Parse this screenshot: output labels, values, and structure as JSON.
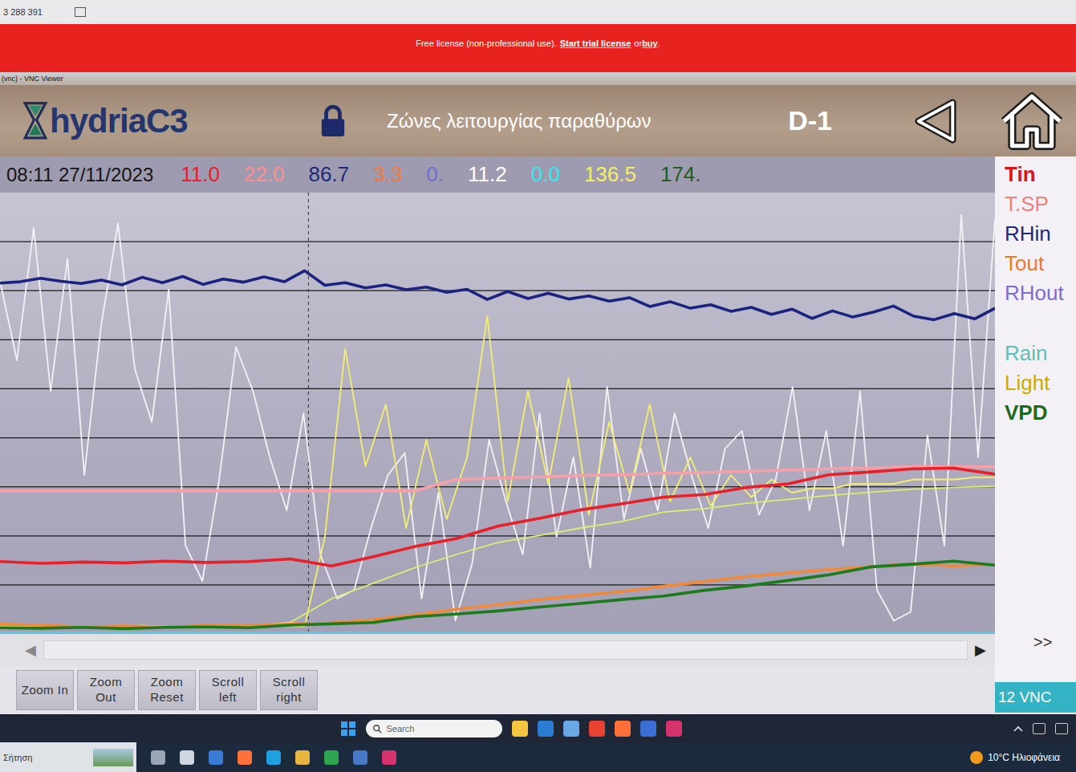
{
  "top_strip": {
    "text": "3 288 391"
  },
  "banner": {
    "prefix": "Free license (non-professional use).",
    "link1": "Start trial license",
    "middle": "or",
    "link2": "buy",
    "suffix": "."
  },
  "vnc_window": {
    "title": "(vnc) - VNC Viewer"
  },
  "header": {
    "logo": "hydriaC3",
    "title": "Ζώνες λειτουργίας παραθύρων",
    "screen_id": "D-1",
    "locked": true
  },
  "readouts": {
    "timestamp": "08:11 27/11/2023",
    "values": [
      {
        "value": "11.0",
        "color": "#e8202a"
      },
      {
        "value": "22.0",
        "color": "#ff8f8f"
      },
      {
        "value": "86.7",
        "color": "#1c2a7a"
      },
      {
        "value": "3.3",
        "color": "#f07a3a"
      },
      {
        "value": "0.",
        "color": "#6f6fd0"
      },
      {
        "value": "11.2",
        "color": "#ffffff"
      },
      {
        "value": "0.0",
        "color": "#35e8f0"
      },
      {
        "value": "136.5",
        "color": "#f4f060"
      },
      {
        "value": "174.",
        "color": "#1d5e1d"
      }
    ]
  },
  "legend": [
    {
      "name": "Tin",
      "color": "#d8141c",
      "bold": true
    },
    {
      "name": "T.SP",
      "color": "#ef8080",
      "bold": false
    },
    {
      "name": "RHin",
      "color": "#1c2a7a",
      "bold": false
    },
    {
      "name": "Tout",
      "color": "#f07a2a",
      "bold": false
    },
    {
      "name": "RHout",
      "color": "#7a6ed0",
      "bold": false
    },
    {
      "name": "Rain",
      "color": "#5cc0b6",
      "bold": false
    },
    {
      "name": "Light",
      "color": "#c9ac00",
      "bold": false
    },
    {
      "name": "VPD",
      "color": "#1d6a1d",
      "bold": true
    }
  ],
  "chart": {
    "cursor": {
      "level": 0.31
    },
    "series": [
      {
        "color": "#f4f1f4",
        "kind": "thin",
        "values": [
          80,
          62,
          92,
          55,
          85,
          36,
          70,
          93,
          60,
          48,
          78,
          20,
          12,
          35,
          65,
          55,
          40,
          28,
          50,
          18,
          8,
          10,
          24,
          36,
          41,
          8,
          32,
          3,
          16,
          44,
          30,
          18,
          50,
          22,
          40,
          15,
          56,
          26,
          42,
          28,
          50,
          36,
          24,
          42,
          46,
          27,
          35,
          56,
          28,
          46,
          20,
          55,
          10,
          3,
          5,
          45,
          20,
          95,
          40,
          94
        ]
      },
      {
        "color": "#f2ee70",
        "kind": "thin",
        "values": [
          1.8,
          1.6,
          1.9,
          1.5,
          1.7,
          1.8,
          1.6,
          1.9,
          1.7,
          1.6,
          1.8,
          1.7,
          1.9,
          1.6,
          1.8,
          1.7,
          22,
          64.6,
          38,
          52,
          24,
          44,
          26,
          40,
          72,
          30,
          55,
          34,
          58,
          27,
          48,
          32,
          52,
          30,
          40,
          29,
          36,
          31,
          35,
          32,
          33,
          33,
          34,
          34,
          34,
          35,
          35,
          35,
          35.5,
          35.5
        ]
      },
      {
        "color": "#d8f070",
        "kind": "thin",
        "values": [
          1.6,
          1.5,
          1.6,
          1.4,
          1.5,
          1.6,
          1.8,
          2.6,
          8.0,
          11.5,
          15.0,
          18.0,
          20.7,
          22.3,
          24.0,
          25.5,
          27.6,
          28.4,
          29.6,
          30.5,
          31.4,
          32.1,
          32.8,
          33.2,
          33.5
        ]
      },
      {
        "color": "#f4a0a8",
        "kind": "bold",
        "values": [
          32.4,
          32.4,
          32.4,
          32.4,
          32.4,
          32.4,
          32.4,
          32.4,
          32.4,
          32.4,
          32.4,
          35.0,
          35.3,
          35.6,
          35.9,
          36.1,
          36.4,
          36.6,
          36.9,
          37.1,
          37.4,
          37.6,
          37.9,
          37.9,
          37.9
        ]
      },
      {
        "color": "#1a2480",
        "kind": "bold",
        "values": [
          79.5,
          79.8,
          80.6,
          79.9,
          79.4,
          80.2,
          79.1,
          80.8,
          79.6,
          81.0,
          79.2,
          80.4,
          79.7,
          80.9,
          79.8,
          82.3,
          79.0,
          79.6,
          78.4,
          79.1,
          78.0,
          78.6,
          77.4,
          78.1,
          75.8,
          77.6,
          76.0,
          77.2,
          75.9,
          76.6,
          75.4,
          76.2,
          74.2,
          75.3,
          73.8,
          74.6,
          73.1,
          74.0,
          72.4,
          73.6,
          71.5,
          73.2,
          71.8,
          72.9,
          74.3,
          72.0,
          71.2,
          72.6,
          71.4,
          73.8
        ]
      },
      {
        "color": "#f08a3a",
        "kind": "bold",
        "values": [
          2.2,
          2.0,
          1.6,
          1.8,
          1.5,
          1.9,
          2.0,
          2.2,
          2.5,
          3.2,
          4.3,
          5.6,
          6.6,
          7.8,
          8.7,
          9.6,
          10.8,
          11.9,
          13.0,
          13.8,
          14.6,
          15.2,
          15.9,
          15.4,
          15.8
        ]
      },
      {
        "color": "#1d7a1d",
        "kind": "bold",
        "values": [
          1.4,
          1.3,
          1.5,
          1.2,
          1.5,
          1.6,
          1.4,
          2.0,
          2.3,
          2.6,
          3.9,
          4.5,
          5.2,
          6.1,
          6.9,
          7.8,
          8.6,
          9.9,
          10.9,
          12.1,
          13.4,
          15.2,
          15.8,
          16.5,
          15.6
        ]
      },
      {
        "color": "#e8202a",
        "kind": "bold",
        "values": [
          16.4,
          16.0,
          16.3,
          16.1,
          16.5,
          16.2,
          16.4,
          17.0,
          15.4,
          17.5,
          19.8,
          21.6,
          24.4,
          26.2,
          28.1,
          29.5,
          31.0,
          31.6,
          33.2,
          34.0,
          36.1,
          36.7,
          37.4,
          37.6,
          36.2
        ]
      },
      {
        "color": "#44d8f0",
        "kind": "thin",
        "values": [
          0.4,
          0.4,
          0.4,
          0.4,
          0.4,
          0.4,
          0.4,
          0.4,
          0.4,
          0.4
        ]
      }
    ]
  },
  "scrollbar": {
    "left": "◀",
    "right": "▶"
  },
  "buttons": [
    "Zoom In",
    "Zoom Out",
    "Zoom Reset",
    "Scroll left",
    "Scroll right"
  ],
  "more": ">>",
  "vnc_badge": "12 VNC",
  "taskbar": {
    "search_placeholder": "Search"
  },
  "taskbar2": {
    "search_text": "Σήτηση",
    "weather": "10°C Ηλιοφάνεια"
  }
}
